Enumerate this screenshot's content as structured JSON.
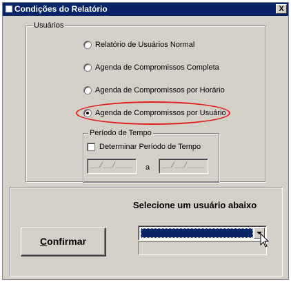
{
  "window": {
    "title": "Condições do Relatório",
    "close_label": "X"
  },
  "usuarios_group": {
    "legend": "Usuários",
    "options": [
      {
        "label": "Relatório de Usuários Normal",
        "checked": false
      },
      {
        "label": "Agenda de Compromissos Completa",
        "checked": false
      },
      {
        "label": "Agenda de Compromissos por Horário",
        "checked": false
      },
      {
        "label": "Agenda de Compromissos por Usuário",
        "checked": true
      }
    ],
    "highlight_color": "#e21a1a"
  },
  "periodo_group": {
    "legend": "Período de Tempo",
    "checkbox_label": "Determinar Período de Tempo",
    "checkbox_checked": false,
    "date_from": "__/__/____",
    "date_sep": "a",
    "date_to": "__/__/____"
  },
  "bottom_panel": {
    "prompt": "Selecione um usuário abaixo",
    "confirm_accel": "C",
    "confirm_rest": "onfirmar",
    "user_select_value": ""
  },
  "colors": {
    "titlebar": "#0a246a",
    "face": "#d4d0c8",
    "selection": "#0a246a"
  }
}
